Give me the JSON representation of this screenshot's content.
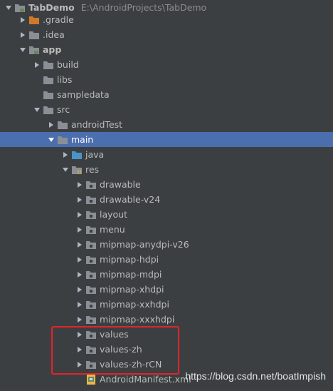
{
  "project": {
    "name": "TabDemo",
    "path": "E:\\AndroidProjects\\TabDemo"
  },
  "colors": {
    "selection": "#4b6eaf",
    "highlight_box": "#e0252b",
    "folder": "#8a8f96",
    "folder_orange": "#d0792a",
    "folder_blue": "#4a93c6"
  },
  "tree": {
    "rows": [
      {
        "label": "TabDemo",
        "path": "E:\\AndroidProjects\\TabDemo",
        "arrow": "down",
        "icon": "module-folder-icon",
        "bold": true
      },
      {
        "label": ".gradle",
        "arrow": "right",
        "icon": "orange-folder-icon"
      },
      {
        "label": ".idea",
        "arrow": "right",
        "icon": "folder-icon"
      },
      {
        "label": "app",
        "arrow": "down",
        "icon": "module-folder-icon",
        "bold": true
      },
      {
        "label": "build",
        "arrow": "right",
        "icon": "folder-icon"
      },
      {
        "label": "libs",
        "arrow": "none",
        "icon": "folder-icon"
      },
      {
        "label": "sampledata",
        "arrow": "none",
        "icon": "folder-icon"
      },
      {
        "label": "src",
        "arrow": "down",
        "icon": "folder-icon"
      },
      {
        "label": "androidTest",
        "arrow": "right",
        "icon": "folder-icon"
      },
      {
        "label": "main",
        "arrow": "down",
        "icon": "folder-icon",
        "selected": true
      },
      {
        "label": "java",
        "arrow": "right",
        "icon": "source-folder-icon"
      },
      {
        "label": "res",
        "arrow": "down",
        "icon": "resource-folder-icon"
      },
      {
        "label": "drawable",
        "arrow": "right",
        "icon": "package-folder-icon"
      },
      {
        "label": "drawable-v24",
        "arrow": "right",
        "icon": "package-folder-icon"
      },
      {
        "label": "layout",
        "arrow": "right",
        "icon": "package-folder-icon"
      },
      {
        "label": "menu",
        "arrow": "right",
        "icon": "package-folder-icon"
      },
      {
        "label": "mipmap-anydpi-v26",
        "arrow": "right",
        "icon": "package-folder-icon"
      },
      {
        "label": "mipmap-hdpi",
        "arrow": "right",
        "icon": "package-folder-icon"
      },
      {
        "label": "mipmap-mdpi",
        "arrow": "right",
        "icon": "package-folder-icon"
      },
      {
        "label": "mipmap-xhdpi",
        "arrow": "right",
        "icon": "package-folder-icon"
      },
      {
        "label": "mipmap-xxhdpi",
        "arrow": "right",
        "icon": "package-folder-icon"
      },
      {
        "label": "mipmap-xxxhdpi",
        "arrow": "right",
        "icon": "package-folder-icon"
      },
      {
        "label": "values",
        "arrow": "right",
        "icon": "package-folder-icon"
      },
      {
        "label": "values-zh",
        "arrow": "right",
        "icon": "package-folder-icon"
      },
      {
        "label": "values-zh-rCN",
        "arrow": "right",
        "icon": "package-folder-icon"
      },
      {
        "label": "AndroidManifest.xml",
        "arrow": "none",
        "icon": "manifest-file-icon"
      }
    ]
  },
  "watermark": "https://blog.csdn.net/boatImpish"
}
